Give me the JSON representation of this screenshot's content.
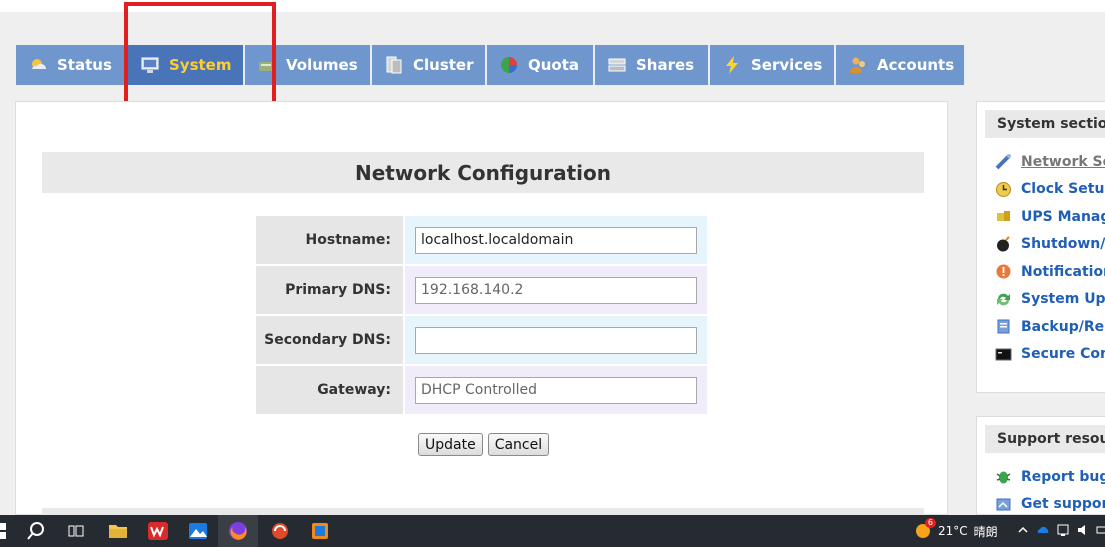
{
  "tabs": [
    {
      "label": "Status",
      "icon": "status-icon"
    },
    {
      "label": "System",
      "icon": "system-icon",
      "active": true
    },
    {
      "label": "Volumes",
      "icon": "volumes-icon"
    },
    {
      "label": "Cluster",
      "icon": "cluster-icon"
    },
    {
      "label": "Quota",
      "icon": "quota-icon"
    },
    {
      "label": "Shares",
      "icon": "shares-icon"
    },
    {
      "label": "Services",
      "icon": "services-icon"
    },
    {
      "label": "Accounts",
      "icon": "accounts-icon"
    }
  ],
  "network_config": {
    "title": "Network Configuration",
    "hostname": {
      "label": "Hostname:",
      "value": "localhost.localdomain"
    },
    "primary_dns": {
      "label": "Primary DNS:",
      "value": "192.168.140.2"
    },
    "secondary_dns": {
      "label": "Secondary DNS:",
      "value": ""
    },
    "gateway": {
      "label": "Gateway:",
      "value": "DHCP Controlled"
    },
    "update_label": "Update",
    "cancel_label": "Cancel"
  },
  "system_section": {
    "title": "System section",
    "items": [
      {
        "label": "Network Se",
        "icon": "network-icon",
        "current": true
      },
      {
        "label": "Clock Setup",
        "icon": "clock-icon"
      },
      {
        "label": "UPS Manag",
        "icon": "ups-icon"
      },
      {
        "label": "Shutdown/",
        "icon": "shutdown-icon"
      },
      {
        "label": "Notification",
        "icon": "notification-icon"
      },
      {
        "label": "System Upd",
        "icon": "update-icon"
      },
      {
        "label": "Backup/Re",
        "icon": "backup-icon"
      },
      {
        "label": "Secure Con",
        "icon": "console-icon"
      }
    ]
  },
  "support_section": {
    "title": "Support resou",
    "items": [
      {
        "label": "Report bug",
        "icon": "bug-icon"
      },
      {
        "label": "Get support",
        "icon": "support-icon"
      }
    ]
  },
  "taskbar": {
    "weather_temp": "21°C",
    "weather_desc": "晴朗",
    "weather_badge": "6"
  },
  "colors": {
    "tab_bg": "#6f97cd",
    "tab_active_bg": "#4a74b8",
    "tab_active_text": "#ffcc33",
    "link": "#1f5fb6",
    "highlight": "#e02020"
  }
}
